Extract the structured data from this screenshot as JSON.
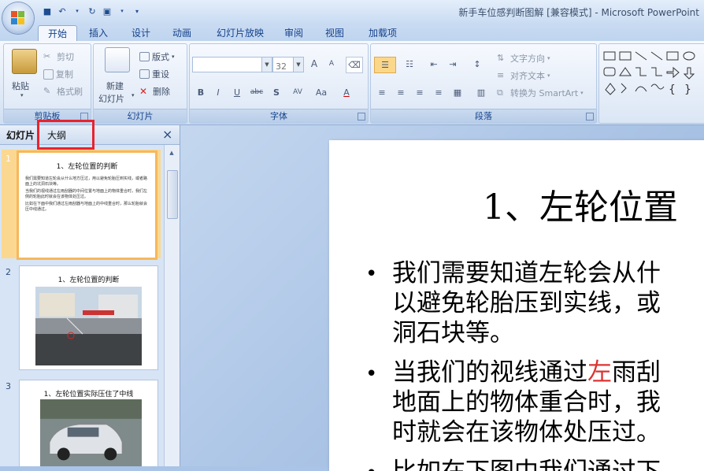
{
  "window": {
    "title": "新手车位感判断图解 [兼容模式] - Microsoft PowerPoint"
  },
  "ribbon_tabs": [
    "开始",
    "插入",
    "设计",
    "动画",
    "幻灯片放映",
    "审阅",
    "视图",
    "加载项"
  ],
  "ribbon": {
    "clipboard": {
      "label": "剪贴板",
      "paste": "粘贴",
      "cut": "剪切",
      "copy": "复制",
      "format_painter": "格式刷"
    },
    "slides": {
      "label": "幻灯片",
      "new_slide_line1": "新建",
      "new_slide_line2": "幻灯片",
      "layout": "版式",
      "reset": "重设",
      "delete": "删除"
    },
    "font": {
      "label": "字体",
      "font_name": "",
      "font_size": "32",
      "bold": "B",
      "italic": "I",
      "underline": "U",
      "strike": "abc",
      "shadow": "S",
      "spacing": "AV",
      "case": "Aa",
      "color": "A",
      "grow": "A",
      "shrink": "A"
    },
    "paragraph": {
      "label": "段落",
      "text_direction": "文字方向",
      "align_text": "对齐文本",
      "smartart": "转换为 SmartArt"
    },
    "drawing": {}
  },
  "left_panel": {
    "tab_slides": "幻灯片",
    "tab_outline": "大纲",
    "close": "×"
  },
  "thumbnails": [
    {
      "num": "1",
      "title": "1、左轮位置的判断",
      "lines": [
        "我们需要知道左轮会从什么地方压过，用以避免轮胎压到实线，或者路面上的坑洞石块等。",
        "当我们的视线通过左雨刮器的中间位置与地面上的物体重合时，我们左侧的轮胎此时就会在该物体处压过。",
        "比如在下面中我们通过左雨刮器与地面上的中线重合时，那么轮胎就会压中线通过。"
      ]
    },
    {
      "num": "2",
      "title": "1、左轮位置的判断"
    },
    {
      "num": "3",
      "title": "1、左轮位置实际压住了中线"
    }
  ],
  "slide": {
    "title": "1、左轮位置",
    "bullets": [
      [
        "我们需要知道左轮会从什",
        "以避免轮胎压到实线，或",
        "洞石块等。"
      ],
      [
        "当我们的视线通过",
        "左",
        "雨刮",
        "地面上的物体重合时，我",
        "时就会在该物体处压过。"
      ],
      [
        "比如在下图中我们通过下"
      ]
    ]
  },
  "colors": {
    "accent_red": "#d33333",
    "tab_blue": "#15428b",
    "highlight": "#e8232e"
  }
}
